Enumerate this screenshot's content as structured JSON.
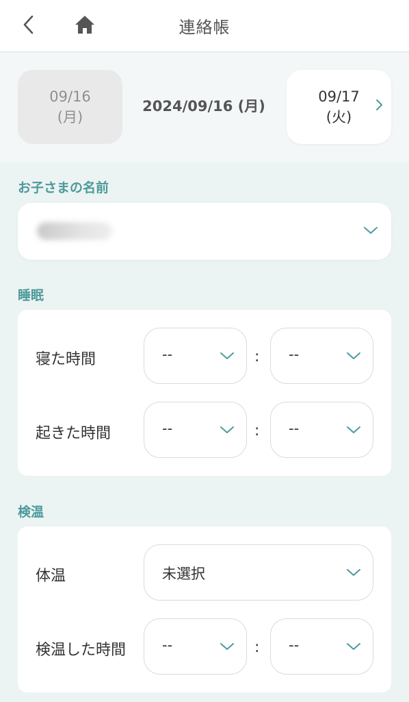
{
  "header": {
    "title": "連絡帳"
  },
  "dates": {
    "prev_date": "09/16",
    "prev_day": "(月)",
    "current": "2024/09/16 (月)",
    "next_date": "09/17",
    "next_day": "(火)"
  },
  "child": {
    "label": "お子さまの名前"
  },
  "sleep": {
    "label": "睡眠",
    "sleep_time_label": "寝た時間",
    "sleep_hour": "--",
    "sleep_minute": "--",
    "wake_time_label": "起きた時間",
    "wake_hour": "--",
    "wake_minute": "--"
  },
  "temp": {
    "label": "検温",
    "body_temp_label": "体温",
    "body_temp_value": "未選択",
    "check_time_label": "検温した時間",
    "check_hour": "--",
    "check_minute": "--"
  },
  "colon": ":",
  "colors": {
    "accent": "#4c9a9a",
    "chevron": "#4c9a9a"
  }
}
